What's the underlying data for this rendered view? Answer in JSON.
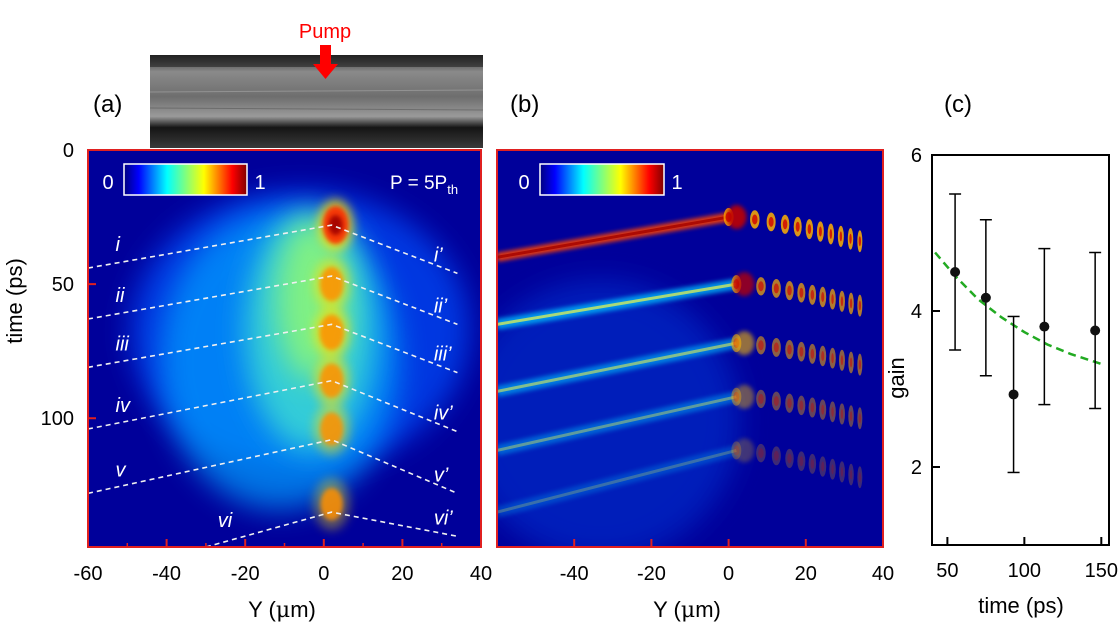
{
  "top": {
    "pump_label": "Pump",
    "pump_color": "#ff0000"
  },
  "chart_data": [
    {
      "panel": "(a)",
      "type": "heatmap",
      "xlabel_prefix": "Y (",
      "xlabel_greek": "μ",
      "xlabel_suffix": "m)",
      "ylabel": "time (ps)",
      "xlim": [
        -60,
        40
      ],
      "ylim": [
        0,
        148
      ],
      "y_inverted": true,
      "xticks": [
        -60,
        -40,
        -20,
        0,
        20,
        40
      ],
      "yticks": [
        0,
        50,
        100
      ],
      "colorbar": {
        "min_label": "0",
        "max_label": "1",
        "colormap": "jet"
      },
      "annotation": {
        "text": "P = 5P",
        "subscript": "th"
      },
      "frame_color": "#e02020",
      "dashed_lines": [
        {
          "label": "i",
          "label_prime": "i’",
          "from": [
            -60,
            44
          ],
          "apex": [
            2,
            28
          ],
          "to": [
            34,
            46
          ]
        },
        {
          "label": "ii",
          "label_prime": "ii’",
          "from": [
            -60,
            63
          ],
          "apex": [
            2,
            47
          ],
          "to": [
            34,
            65
          ]
        },
        {
          "label": "iii",
          "label_prime": "iii’",
          "from": [
            -60,
            81
          ],
          "apex": [
            2,
            65
          ],
          "to": [
            34,
            83
          ]
        },
        {
          "label": "iv",
          "label_prime": "iv’",
          "from": [
            -60,
            104
          ],
          "apex": [
            2,
            86
          ],
          "to": [
            34,
            105
          ]
        },
        {
          "label": "v",
          "label_prime": "v’",
          "from": [
            -60,
            128
          ],
          "apex": [
            2,
            108
          ],
          "to": [
            34,
            128
          ]
        },
        {
          "label": "vi",
          "label_prime": "vi’",
          "from": [
            -30,
            148
          ],
          "apex": [
            2,
            135
          ],
          "to": [
            34,
            144
          ]
        }
      ],
      "intensity_peaks": [
        {
          "y": 3,
          "t": 28,
          "value": 1.0
        },
        {
          "y": 2,
          "t": 50,
          "value": 0.7
        },
        {
          "y": 2,
          "t": 68,
          "value": 0.8
        },
        {
          "y": 2,
          "t": 86,
          "value": 0.7
        },
        {
          "y": 2,
          "t": 104,
          "value": 0.6
        },
        {
          "y": 2,
          "t": 132,
          "value": 0.5
        }
      ]
    },
    {
      "panel": "(b)",
      "type": "heatmap",
      "xlabel_prefix": "Y (",
      "xlabel_greek": "μ",
      "xlabel_suffix": "m)",
      "xlim": [
        -60,
        40
      ],
      "ylim": [
        0,
        148
      ],
      "y_inverted": true,
      "xticks": [
        -40,
        -20,
        0,
        20,
        40
      ],
      "colorbar": {
        "min_label": "0",
        "max_label": "1",
        "colormap": "jet"
      },
      "frame_color": "#e02020",
      "simulated_fronts": [
        {
          "apex": [
            0,
            25
          ],
          "left_t_at_minus60": 40,
          "right_t_at_34": 34
        },
        {
          "apex": [
            2,
            50
          ],
          "left_t_at_minus60": 65,
          "right_t_at_34": 58
        },
        {
          "apex": [
            2,
            72
          ],
          "left_t_at_minus60": 90,
          "right_t_at_34": 80
        },
        {
          "apex": [
            2,
            92
          ],
          "left_t_at_minus60": 112,
          "right_t_at_34": 100
        },
        {
          "apex": [
            2,
            112
          ],
          "left_t_at_minus60": 135,
          "right_t_at_34": 122
        }
      ]
    },
    {
      "panel": "(c)",
      "type": "scatter",
      "xlabel": "time (ps)",
      "ylabel": "gain",
      "xlim": [
        40,
        155
      ],
      "ylim": [
        1,
        6
      ],
      "xticks": [
        50,
        100,
        150
      ],
      "yticks": [
        2,
        4,
        6
      ],
      "points": [
        {
          "x": 55,
          "y": 4.5,
          "err": 1.0
        },
        {
          "x": 75,
          "y": 4.17,
          "err": 1.0
        },
        {
          "x": 93,
          "y": 2.93,
          "err": 1.0
        },
        {
          "x": 113,
          "y": 3.8,
          "err": 1.0
        },
        {
          "x": 146,
          "y": 3.75,
          "err": 1.0
        }
      ],
      "fit": {
        "style": "dashed",
        "color": "#22aa22",
        "x": [
          42,
          55,
          70,
          85,
          100,
          115,
          130,
          150
        ],
        "y": [
          4.75,
          4.45,
          4.15,
          3.92,
          3.73,
          3.57,
          3.45,
          3.32
        ]
      }
    }
  ]
}
